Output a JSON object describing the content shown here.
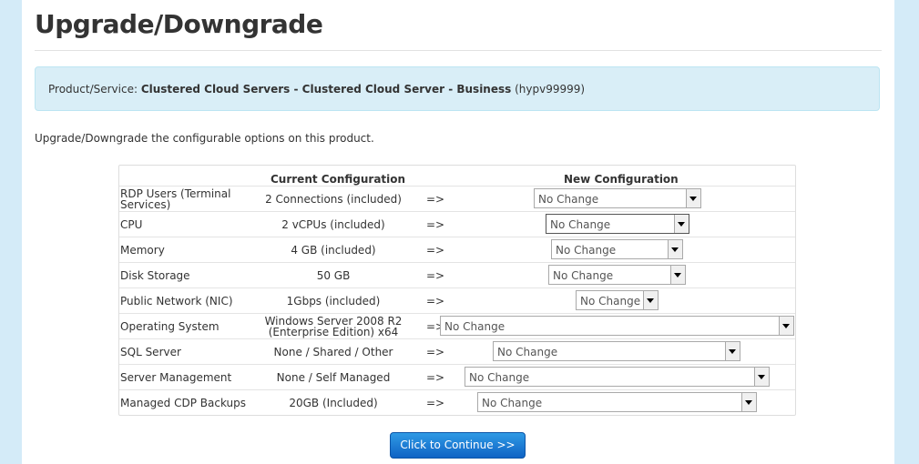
{
  "page": {
    "title": "Upgrade/Downgrade",
    "intro": "Upgrade/Downgrade the configurable options on this product."
  },
  "info": {
    "label": "Product/Service:",
    "product": "Clustered Cloud Servers - Clustered Cloud Server - Business",
    "service_id": "(hypv99999)"
  },
  "table": {
    "header_current": "Current Configuration",
    "header_new": "New Configuration",
    "arrow": "=>",
    "rows": [
      {
        "label": "RDP Users (Terminal Services)",
        "current": "2 Connections (included)",
        "new": "No Change"
      },
      {
        "label": "CPU",
        "current": "2 vCPUs (included)",
        "new": "No Change"
      },
      {
        "label": "Memory",
        "current": "4 GB (included)",
        "new": "No Change"
      },
      {
        "label": "Disk Storage",
        "current": "50 GB",
        "new": "No Change"
      },
      {
        "label": "Public Network (NIC)",
        "current": "1Gbps (included)",
        "new": "No Change"
      },
      {
        "label": "Operating System",
        "current": "Windows Server 2008 R2 (Enterprise Edition) x64",
        "new": "No Change"
      },
      {
        "label": "SQL Server",
        "current": "None / Shared / Other",
        "new": "No Change"
      },
      {
        "label": "Server Management",
        "current": "None / Self Managed",
        "new": "No Change"
      },
      {
        "label": "Managed CDP Backups",
        "current": "20GB (Included)",
        "new": "No Change"
      }
    ]
  },
  "actions": {
    "continue_label": "Click to Continue >>"
  },
  "colors": {
    "background": "#d4ebf8",
    "info_box": "#d9eef7",
    "button": "#1a7ad4"
  }
}
